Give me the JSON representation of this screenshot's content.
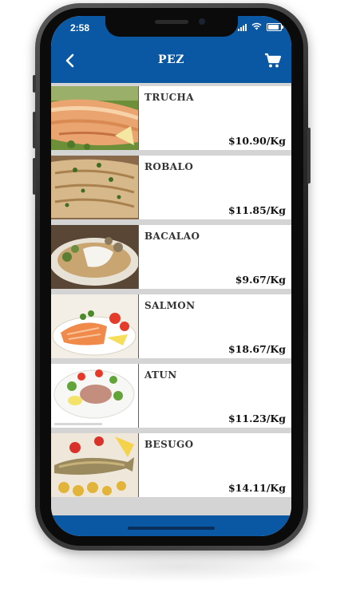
{
  "status_bar": {
    "time": "2:58"
  },
  "header": {
    "title": "PEZ",
    "back_icon": "chevron-left-icon",
    "cart_icon": "shopping-cart-icon"
  },
  "colors": {
    "primary": "#0a57a4",
    "divider": "#d4d4d4",
    "accent_border": "#c0392b"
  },
  "products": [
    {
      "name": "TRUCHA",
      "price": "$10.90/Kg",
      "image": "trout-fillet-photo"
    },
    {
      "name": "ROBALO",
      "price": "$11.85/Kg",
      "image": "sea-bass-fillet-photo"
    },
    {
      "name": "BACALAO",
      "price": "$9.67/Kg",
      "image": "cod-dish-photo"
    },
    {
      "name": "SALMON",
      "price": "$18.67/Kg",
      "image": "salmon-plate-photo"
    },
    {
      "name": "ATUN",
      "price": "$11.23/Kg",
      "image": "tuna-salad-photo"
    },
    {
      "name": "BESUGO",
      "price": "$14.11/Kg",
      "image": "sea-bream-photo"
    }
  ]
}
